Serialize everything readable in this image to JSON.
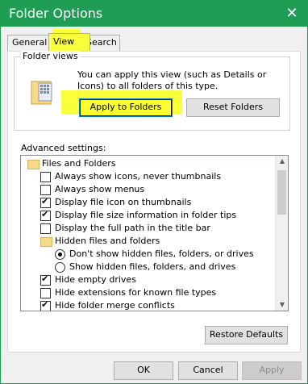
{
  "window": {
    "title": "Folder Options",
    "close_glyph": "✕"
  },
  "tabs": [
    {
      "label": "General"
    },
    {
      "label": "View"
    },
    {
      "label": "Search"
    }
  ],
  "folder_views": {
    "group_title": "Folder views",
    "description": "You can apply this view (such as Details or Icons) to all folders of this type.",
    "apply_button": "Apply to Folders",
    "reset_button": "Reset Folders"
  },
  "advanced": {
    "label": "Advanced settings:",
    "items": [
      {
        "label": "Files and Folders",
        "type": "folder",
        "indent": 0
      },
      {
        "label": "Always show icons, never thumbnails",
        "type": "checkbox",
        "checked": false,
        "indent": 1
      },
      {
        "label": "Always show menus",
        "type": "checkbox",
        "checked": false,
        "indent": 1
      },
      {
        "label": "Display file icon on thumbnails",
        "type": "checkbox",
        "checked": true,
        "indent": 1
      },
      {
        "label": "Display file size information in folder tips",
        "type": "checkbox",
        "checked": true,
        "indent": 1
      },
      {
        "label": "Display the full path in the title bar",
        "type": "checkbox",
        "checked": false,
        "indent": 1
      },
      {
        "label": "Hidden files and folders",
        "type": "folder",
        "indent": 1
      },
      {
        "label": "Don't show hidden files, folders, or drives",
        "type": "radio",
        "checked": true,
        "indent": 2
      },
      {
        "label": "Show hidden files, folders, and drives",
        "type": "radio",
        "checked": false,
        "indent": 2
      },
      {
        "label": "Hide empty drives",
        "type": "checkbox",
        "checked": true,
        "indent": 1
      },
      {
        "label": "Hide extensions for known file types",
        "type": "checkbox",
        "checked": false,
        "indent": 1
      },
      {
        "label": "Hide folder merge conflicts",
        "type": "checkbox",
        "checked": true,
        "indent": 1
      }
    ],
    "restore_button": "Restore Defaults"
  },
  "footer": {
    "ok": "OK",
    "cancel": "Cancel",
    "apply": "Apply"
  },
  "colors": {
    "titlebar": "#1f9d55",
    "highlight": "#f9ff3a",
    "focus_border": "#0078d7"
  }
}
